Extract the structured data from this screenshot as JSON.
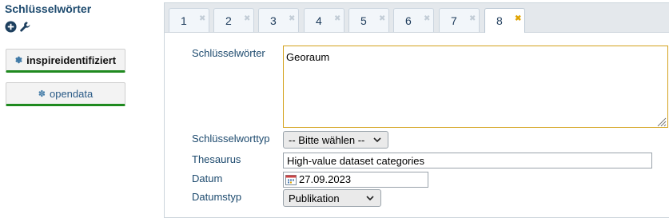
{
  "sidebar": {
    "title": "Schlüsselwörter",
    "icons": [
      "add-circle-icon",
      "wrench-icon"
    ],
    "keywords": [
      {
        "label": "inspireidentifiziert",
        "icon": "gear-icon"
      },
      {
        "label": "opendata",
        "icon": "gear-icon"
      }
    ]
  },
  "tabs": [
    {
      "label": "1",
      "active": false
    },
    {
      "label": "2",
      "active": false
    },
    {
      "label": "3",
      "active": false
    },
    {
      "label": "4",
      "active": false
    },
    {
      "label": "5",
      "active": false
    },
    {
      "label": "6",
      "active": false
    },
    {
      "label": "7",
      "active": false
    },
    {
      "label": "8",
      "active": true
    }
  ],
  "tab_close_glyph": "✖",
  "form": {
    "keywords_label": "Schlüsselwörter",
    "keywords_value": "Georaum",
    "keywordtype_label": "Schlüsselworttyp",
    "keywordtype_value": "-- Bitte wählen --",
    "thesaurus_label": "Thesaurus",
    "thesaurus_value": "High-value dataset categories",
    "date_label": "Datum",
    "date_value": "27.09.2023",
    "datetype_label": "Datumstyp",
    "datetype_value": "Publikation"
  },
  "colors": {
    "accent_green": "#1f8a1f",
    "title_blue": "#1d4a6e",
    "active_tab_x": "#e0a300",
    "textarea_border": "#d4a21c"
  }
}
